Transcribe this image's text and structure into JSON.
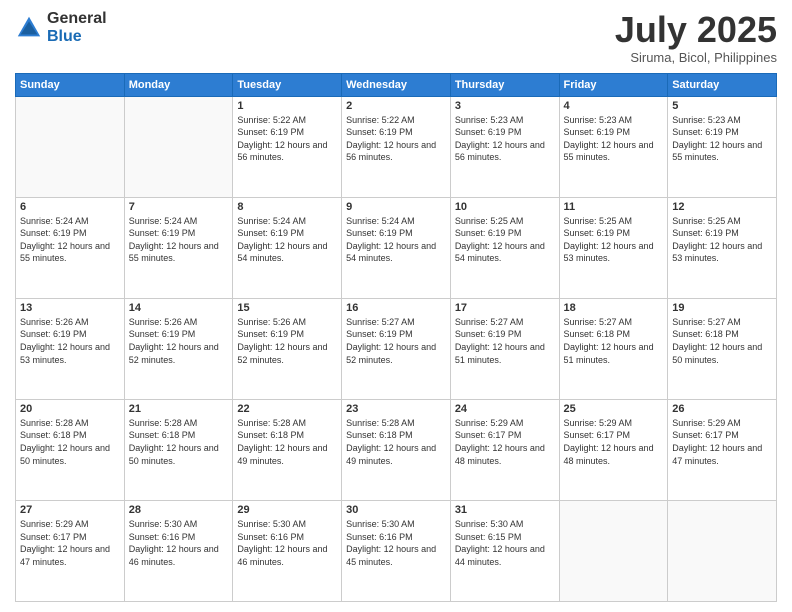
{
  "header": {
    "logo_general": "General",
    "logo_blue": "Blue",
    "month_title": "July 2025",
    "location": "Siruma, Bicol, Philippines"
  },
  "weekdays": [
    "Sunday",
    "Monday",
    "Tuesday",
    "Wednesday",
    "Thursday",
    "Friday",
    "Saturday"
  ],
  "weeks": [
    [
      {
        "day": null
      },
      {
        "day": null
      },
      {
        "day": "1",
        "sunrise": "Sunrise: 5:22 AM",
        "sunset": "Sunset: 6:19 PM",
        "daylight": "Daylight: 12 hours and 56 minutes."
      },
      {
        "day": "2",
        "sunrise": "Sunrise: 5:22 AM",
        "sunset": "Sunset: 6:19 PM",
        "daylight": "Daylight: 12 hours and 56 minutes."
      },
      {
        "day": "3",
        "sunrise": "Sunrise: 5:23 AM",
        "sunset": "Sunset: 6:19 PM",
        "daylight": "Daylight: 12 hours and 56 minutes."
      },
      {
        "day": "4",
        "sunrise": "Sunrise: 5:23 AM",
        "sunset": "Sunset: 6:19 PM",
        "daylight": "Daylight: 12 hours and 55 minutes."
      },
      {
        "day": "5",
        "sunrise": "Sunrise: 5:23 AM",
        "sunset": "Sunset: 6:19 PM",
        "daylight": "Daylight: 12 hours and 55 minutes."
      }
    ],
    [
      {
        "day": "6",
        "sunrise": "Sunrise: 5:24 AM",
        "sunset": "Sunset: 6:19 PM",
        "daylight": "Daylight: 12 hours and 55 minutes."
      },
      {
        "day": "7",
        "sunrise": "Sunrise: 5:24 AM",
        "sunset": "Sunset: 6:19 PM",
        "daylight": "Daylight: 12 hours and 55 minutes."
      },
      {
        "day": "8",
        "sunrise": "Sunrise: 5:24 AM",
        "sunset": "Sunset: 6:19 PM",
        "daylight": "Daylight: 12 hours and 54 minutes."
      },
      {
        "day": "9",
        "sunrise": "Sunrise: 5:24 AM",
        "sunset": "Sunset: 6:19 PM",
        "daylight": "Daylight: 12 hours and 54 minutes."
      },
      {
        "day": "10",
        "sunrise": "Sunrise: 5:25 AM",
        "sunset": "Sunset: 6:19 PM",
        "daylight": "Daylight: 12 hours and 54 minutes."
      },
      {
        "day": "11",
        "sunrise": "Sunrise: 5:25 AM",
        "sunset": "Sunset: 6:19 PM",
        "daylight": "Daylight: 12 hours and 53 minutes."
      },
      {
        "day": "12",
        "sunrise": "Sunrise: 5:25 AM",
        "sunset": "Sunset: 6:19 PM",
        "daylight": "Daylight: 12 hours and 53 minutes."
      }
    ],
    [
      {
        "day": "13",
        "sunrise": "Sunrise: 5:26 AM",
        "sunset": "Sunset: 6:19 PM",
        "daylight": "Daylight: 12 hours and 53 minutes."
      },
      {
        "day": "14",
        "sunrise": "Sunrise: 5:26 AM",
        "sunset": "Sunset: 6:19 PM",
        "daylight": "Daylight: 12 hours and 52 minutes."
      },
      {
        "day": "15",
        "sunrise": "Sunrise: 5:26 AM",
        "sunset": "Sunset: 6:19 PM",
        "daylight": "Daylight: 12 hours and 52 minutes."
      },
      {
        "day": "16",
        "sunrise": "Sunrise: 5:27 AM",
        "sunset": "Sunset: 6:19 PM",
        "daylight": "Daylight: 12 hours and 52 minutes."
      },
      {
        "day": "17",
        "sunrise": "Sunrise: 5:27 AM",
        "sunset": "Sunset: 6:19 PM",
        "daylight": "Daylight: 12 hours and 51 minutes."
      },
      {
        "day": "18",
        "sunrise": "Sunrise: 5:27 AM",
        "sunset": "Sunset: 6:18 PM",
        "daylight": "Daylight: 12 hours and 51 minutes."
      },
      {
        "day": "19",
        "sunrise": "Sunrise: 5:27 AM",
        "sunset": "Sunset: 6:18 PM",
        "daylight": "Daylight: 12 hours and 50 minutes."
      }
    ],
    [
      {
        "day": "20",
        "sunrise": "Sunrise: 5:28 AM",
        "sunset": "Sunset: 6:18 PM",
        "daylight": "Daylight: 12 hours and 50 minutes."
      },
      {
        "day": "21",
        "sunrise": "Sunrise: 5:28 AM",
        "sunset": "Sunset: 6:18 PM",
        "daylight": "Daylight: 12 hours and 50 minutes."
      },
      {
        "day": "22",
        "sunrise": "Sunrise: 5:28 AM",
        "sunset": "Sunset: 6:18 PM",
        "daylight": "Daylight: 12 hours and 49 minutes."
      },
      {
        "day": "23",
        "sunrise": "Sunrise: 5:28 AM",
        "sunset": "Sunset: 6:18 PM",
        "daylight": "Daylight: 12 hours and 49 minutes."
      },
      {
        "day": "24",
        "sunrise": "Sunrise: 5:29 AM",
        "sunset": "Sunset: 6:17 PM",
        "daylight": "Daylight: 12 hours and 48 minutes."
      },
      {
        "day": "25",
        "sunrise": "Sunrise: 5:29 AM",
        "sunset": "Sunset: 6:17 PM",
        "daylight": "Daylight: 12 hours and 48 minutes."
      },
      {
        "day": "26",
        "sunrise": "Sunrise: 5:29 AM",
        "sunset": "Sunset: 6:17 PM",
        "daylight": "Daylight: 12 hours and 47 minutes."
      }
    ],
    [
      {
        "day": "27",
        "sunrise": "Sunrise: 5:29 AM",
        "sunset": "Sunset: 6:17 PM",
        "daylight": "Daylight: 12 hours and 47 minutes."
      },
      {
        "day": "28",
        "sunrise": "Sunrise: 5:30 AM",
        "sunset": "Sunset: 6:16 PM",
        "daylight": "Daylight: 12 hours and 46 minutes."
      },
      {
        "day": "29",
        "sunrise": "Sunrise: 5:30 AM",
        "sunset": "Sunset: 6:16 PM",
        "daylight": "Daylight: 12 hours and 46 minutes."
      },
      {
        "day": "30",
        "sunrise": "Sunrise: 5:30 AM",
        "sunset": "Sunset: 6:16 PM",
        "daylight": "Daylight: 12 hours and 45 minutes."
      },
      {
        "day": "31",
        "sunrise": "Sunrise: 5:30 AM",
        "sunset": "Sunset: 6:15 PM",
        "daylight": "Daylight: 12 hours and 44 minutes."
      },
      {
        "day": null
      },
      {
        "day": null
      }
    ]
  ]
}
